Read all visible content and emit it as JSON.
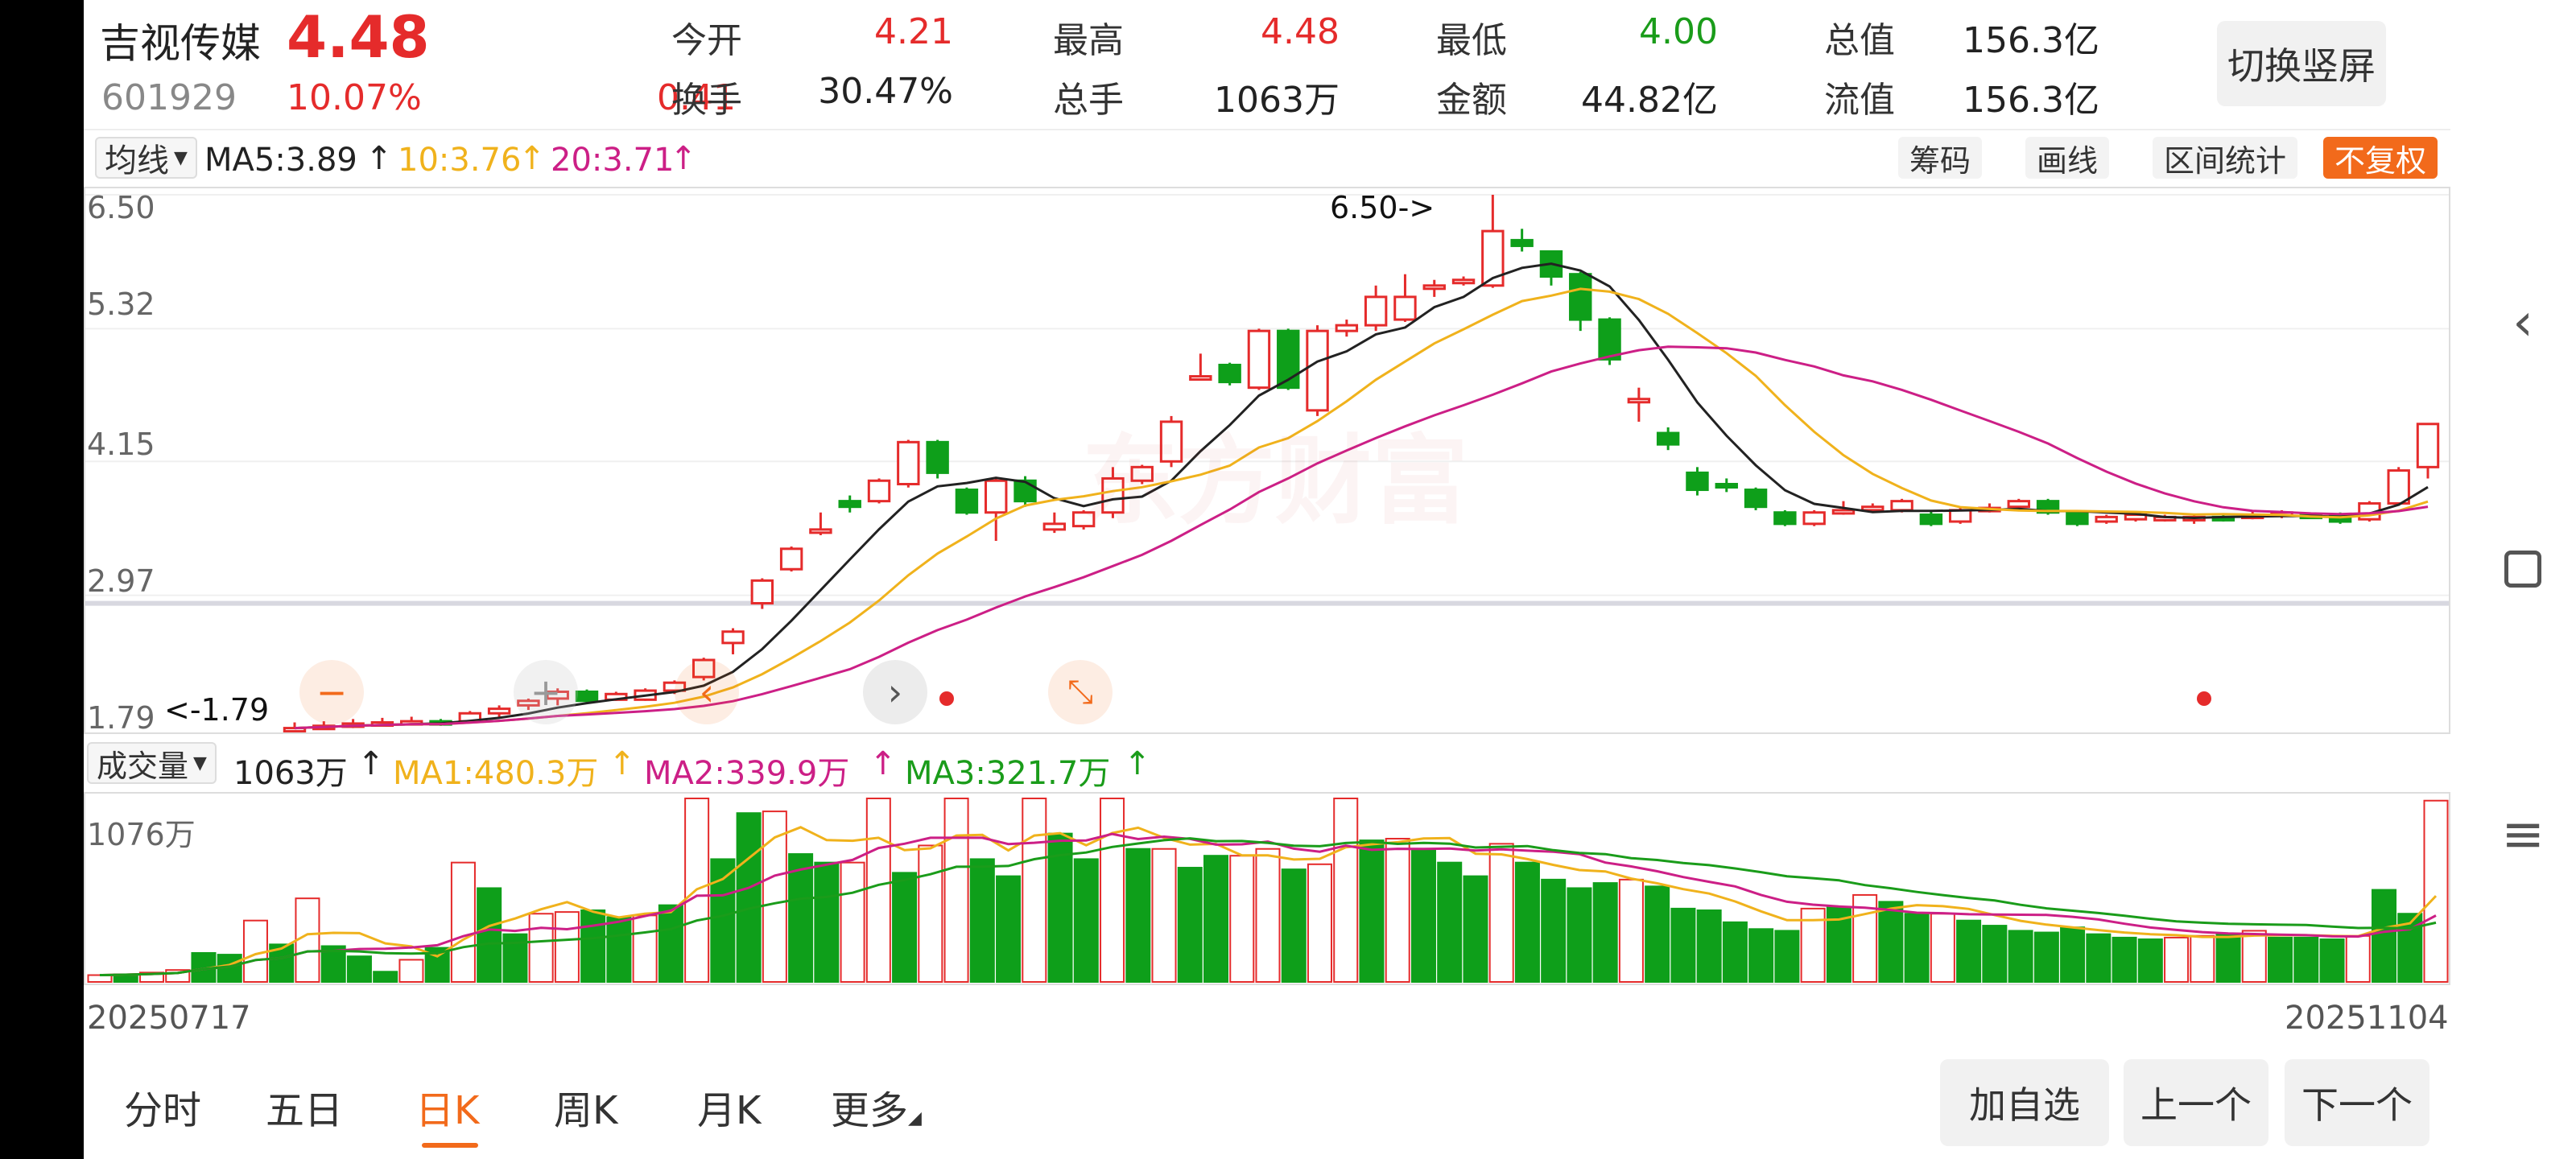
{
  "stock": {
    "name": "吉视传媒",
    "price": "4.48",
    "code": "601929",
    "change_pct": "10.07%",
    "change": "0.41"
  },
  "quote": [
    {
      "label": "今开",
      "value": "4.21",
      "color": "red"
    },
    {
      "label": "最高",
      "value": "4.48",
      "color": "red"
    },
    {
      "label": "最低",
      "value": "4.00",
      "color": "green"
    },
    {
      "label": "总值",
      "value": "156.3亿",
      "color": "dark"
    },
    {
      "label": "换手",
      "value": "30.47%",
      "color": "dark"
    },
    {
      "label": "总手",
      "value": "1063万",
      "color": "dark"
    },
    {
      "label": "金额",
      "value": "44.82亿",
      "color": "dark"
    },
    {
      "label": "流值",
      "value": "156.3亿",
      "color": "dark"
    }
  ],
  "switch_label": "切换竖屏",
  "ma_legend": {
    "selector": "均线",
    "ma5": "MA5:3.89",
    "ma10": "10:3.76",
    "ma20": "20:3.71"
  },
  "tools": [
    "筹码",
    "画线",
    "区间统计",
    "不复权"
  ],
  "price_axis": [
    "6.50",
    "5.32",
    "4.15",
    "2.97",
    "1.79"
  ],
  "annotations": {
    "high": "6.50->",
    "low": "<-1.79"
  },
  "watermark": "东方财富",
  "vol_legend": {
    "selector": "成交量",
    "vol": "1063万",
    "ma1": "MA1:480.3万",
    "ma2": "MA2:339.9万",
    "ma3": "MA3:321.7万"
  },
  "vol_axis": "1076万",
  "dates": {
    "start": "20250717",
    "end": "20251104"
  },
  "tabs": [
    "分时",
    "五日",
    "日K",
    "周K",
    "月K",
    "更多"
  ],
  "active_tab": 2,
  "buttons": {
    "add": "加自选",
    "prev": "上一个",
    "next": "下一个"
  },
  "colors": {
    "up": "#e52b2b",
    "down": "#0e9f1a",
    "ma5": "#222222",
    "ma10": "#f0b21c",
    "ma20": "#cc1f86",
    "accent": "#f26a1b"
  },
  "chart_data": {
    "type": "candlestick",
    "ylim": [
      1.79,
      6.5
    ],
    "candles": [
      [
        1.79,
        1.8,
        1.85,
        1.78
      ],
      [
        1.8,
        1.82,
        1.86,
        1.79
      ],
      [
        1.82,
        1.84,
        1.88,
        1.8
      ],
      [
        1.84,
        1.85,
        1.89,
        1.82
      ],
      [
        1.85,
        1.86,
        1.9,
        1.83
      ],
      [
        1.86,
        1.84,
        1.88,
        1.82
      ],
      [
        1.86,
        1.93,
        1.95,
        1.84
      ],
      [
        1.93,
        1.97,
        2.0,
        1.9
      ],
      [
        2.0,
        2.04,
        2.06,
        1.96
      ],
      [
        2.06,
        2.12,
        2.15,
        2.0
      ],
      [
        2.12,
        2.04,
        2.14,
        2.02
      ],
      [
        2.05,
        2.1,
        2.12,
        2.04
      ],
      [
        2.05,
        2.13,
        2.15,
        2.04
      ],
      [
        2.13,
        2.2,
        2.22,
        2.1
      ],
      [
        2.25,
        2.4,
        2.42,
        2.22
      ],
      [
        2.55,
        2.65,
        2.68,
        2.45
      ],
      [
        2.9,
        3.1,
        3.12,
        2.85
      ],
      [
        3.2,
        3.38,
        3.4,
        3.18
      ],
      [
        3.55,
        3.55,
        3.7,
        3.5
      ],
      [
        3.8,
        3.75,
        3.85,
        3.7
      ],
      [
        3.8,
        3.98,
        4.0,
        3.78
      ],
      [
        3.95,
        4.32,
        4.34,
        3.92
      ],
      [
        4.32,
        4.05,
        4.34,
        4.0
      ],
      [
        3.9,
        3.7,
        3.92,
        3.68
      ],
      [
        3.7,
        3.98,
        4.0,
        3.45
      ],
      [
        3.98,
        3.8,
        4.02,
        3.75
      ],
      [
        3.55,
        3.6,
        3.7,
        3.52
      ],
      [
        3.58,
        3.7,
        3.72,
        3.55
      ],
      [
        3.7,
        4.0,
        4.1,
        3.65
      ],
      [
        3.98,
        4.1,
        4.12,
        3.95
      ],
      [
        4.15,
        4.5,
        4.55,
        4.1
      ],
      [
        4.9,
        4.9,
        5.1,
        4.88
      ],
      [
        5.0,
        4.85,
        5.02,
        4.82
      ],
      [
        4.8,
        5.3,
        5.32,
        4.78
      ],
      [
        5.3,
        4.8,
        5.32,
        4.78
      ],
      [
        4.6,
        5.3,
        5.35,
        4.55
      ],
      [
        5.3,
        5.35,
        5.4,
        5.25
      ],
      [
        5.35,
        5.6,
        5.7,
        5.3
      ],
      [
        5.4,
        5.6,
        5.8,
        5.38
      ],
      [
        5.7,
        5.7,
        5.75,
        5.6
      ],
      [
        5.75,
        5.75,
        5.78,
        5.7
      ],
      [
        5.7,
        6.18,
        6.5,
        5.68
      ],
      [
        6.1,
        6.05,
        6.2,
        6.0
      ],
      [
        6.0,
        5.78,
        6.0,
        5.7
      ],
      [
        5.8,
        5.4,
        5.82,
        5.3
      ],
      [
        5.4,
        5.05,
        5.42,
        5.0
      ],
      [
        4.7,
        4.7,
        4.8,
        4.5
      ],
      [
        4.4,
        4.3,
        4.45,
        4.25
      ],
      [
        4.05,
        3.9,
        4.1,
        3.85
      ],
      [
        3.95,
        3.93,
        4.0,
        3.88
      ],
      [
        3.9,
        3.75,
        3.92,
        3.72
      ],
      [
        3.7,
        3.6,
        3.72,
        3.58
      ],
      [
        3.6,
        3.7,
        3.72,
        3.58
      ],
      [
        3.7,
        3.72,
        3.8,
        3.68
      ],
      [
        3.72,
        3.75,
        3.78,
        3.7
      ],
      [
        3.72,
        3.8,
        3.82,
        3.7
      ],
      [
        3.68,
        3.6,
        3.72,
        3.58
      ],
      [
        3.62,
        3.72,
        3.74,
        3.6
      ],
      [
        3.74,
        3.74,
        3.78,
        3.7
      ],
      [
        3.75,
        3.8,
        3.82,
        3.72
      ],
      [
        3.8,
        3.7,
        3.82,
        3.68
      ],
      [
        3.7,
        3.6,
        3.72,
        3.58
      ],
      [
        3.62,
        3.66,
        3.68,
        3.6
      ],
      [
        3.64,
        3.68,
        3.7,
        3.62
      ],
      [
        3.66,
        3.66,
        3.68,
        3.62
      ],
      [
        3.64,
        3.66,
        3.68,
        3.6
      ],
      [
        3.66,
        3.64,
        3.68,
        3.62
      ],
      [
        3.66,
        3.68,
        3.72,
        3.64
      ],
      [
        3.68,
        3.7,
        3.72,
        3.65
      ],
      [
        3.68,
        3.67,
        3.7,
        3.65
      ],
      [
        3.68,
        3.62,
        3.7,
        3.6
      ],
      [
        3.64,
        3.78,
        3.8,
        3.62
      ],
      [
        3.78,
        4.07,
        4.1,
        3.76
      ],
      [
        4.1,
        4.48,
        4.48,
        4.0
      ]
    ],
    "volume_ylim": [
      0,
      1076
    ],
    "volume": [
      40,
      45,
      55,
      70,
      170,
      160,
      360,
      220,
      490,
      210,
      150,
      60,
      130,
      200,
      700,
      550,
      280,
      400,
      410,
      420,
      380,
      390,
      450,
      1076,
      720,
      990,
      1000,
      750,
      700,
      700,
      1076,
      640,
      800,
      1076,
      720,
      620,
      1076,
      870,
      720,
      1076,
      780,
      780,
      670,
      740,
      740,
      780,
      660,
      690,
      1076,
      830,
      840,
      770,
      700,
      620,
      810,
      700,
      600,
      550,
      580,
      600,
      560,
      430,
      420,
      350,
      310,
      300,
      430,
      440,
      510,
      470,
      400,
      400,
      360,
      330,
      300,
      290,
      320,
      280,
      260,
      250,
      260,
      270,
      280,
      300,
      260,
      260,
      250,
      270,
      540,
      400,
      1063
    ],
    "vol_ma": {
      "ma1": [],
      "ma2": [],
      "ma3": []
    },
    "dates": [
      "20250717",
      "20251104"
    ]
  }
}
